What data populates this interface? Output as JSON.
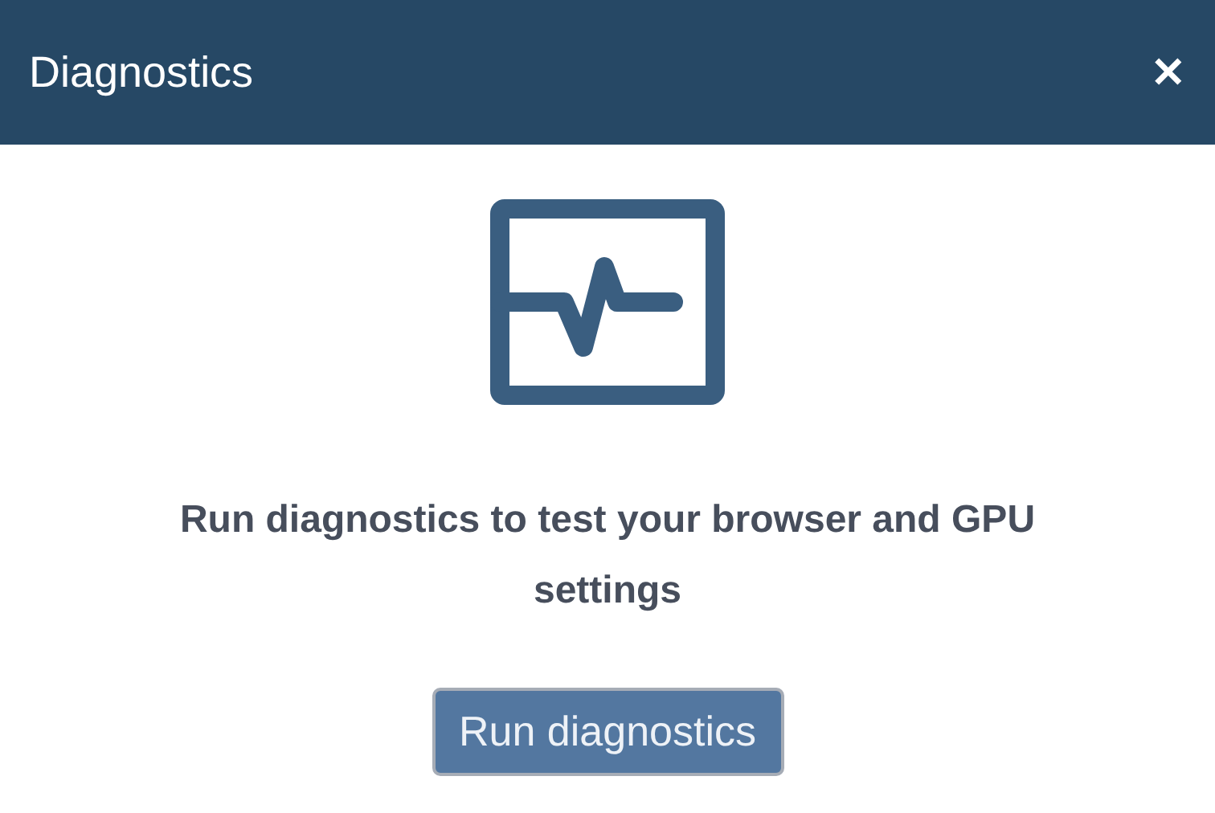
{
  "window": {
    "title": "Diagnostics",
    "close": "✕"
  },
  "message": "Run diagnostics to test your browser and GPU settings",
  "buttons": [
    "Run diagnostics"
  ]
}
